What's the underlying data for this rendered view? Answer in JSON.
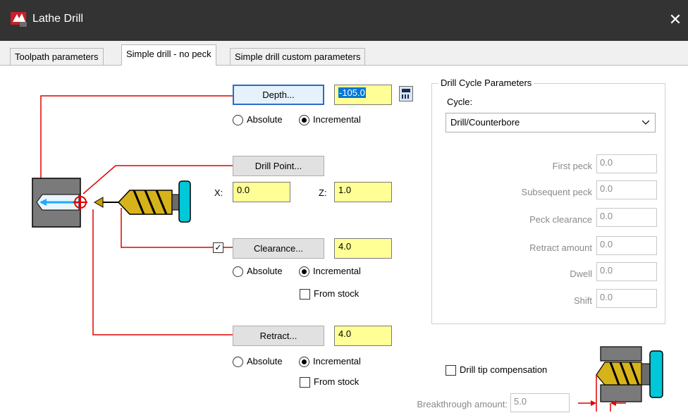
{
  "window": {
    "title": "Lathe Drill",
    "close_glyph": "✕",
    "app_icon": "mastercam-lathe-icon"
  },
  "tabs": [
    {
      "label": "Toolpath parameters"
    },
    {
      "label": "Simple drill - no peck"
    },
    {
      "label": "Simple drill custom parameters"
    }
  ],
  "depth": {
    "button": "Depth...",
    "value": "-105.0",
    "absolute": "Absolute",
    "incremental": "Incremental",
    "mode": "incremental",
    "calc_icon": "calculator-icon"
  },
  "drill_point": {
    "button": "Drill Point...",
    "x_label": "X:",
    "x_value": "0.0",
    "z_label": "Z:",
    "z_value": "1.0"
  },
  "clearance": {
    "enabled": true,
    "check_glyph": "✓",
    "button": "Clearance...",
    "value": "4.0",
    "absolute": "Absolute",
    "incremental": "Incremental",
    "mode": "incremental",
    "from_stock": "From stock",
    "from_stock_checked": false
  },
  "retract": {
    "button": "Retract...",
    "value": "4.0",
    "absolute": "Absolute",
    "incremental": "Incremental",
    "mode": "incremental",
    "from_stock": "From stock",
    "from_stock_checked": false
  },
  "cycle_group": {
    "title": "Drill Cycle Parameters",
    "cycle_label": "Cycle:",
    "cycle_value": "Drill/Counterbore",
    "params": [
      {
        "label": "First peck",
        "value": "0.0"
      },
      {
        "label": "Subsequent peck",
        "value": "0.0"
      },
      {
        "label": "Peck clearance",
        "value": "0.0"
      },
      {
        "label": "Retract amount",
        "value": "0.0"
      },
      {
        "label": "Dwell",
        "value": "0.0"
      },
      {
        "label": "Shift",
        "value": "0.0"
      }
    ]
  },
  "drill_tip": {
    "label": "Drill tip compensation",
    "checked": false
  },
  "breakthrough": {
    "label": "Breakthrough amount:",
    "value": "5.0"
  },
  "colors": {
    "titlebar": "#333333",
    "field_yellow": "#ffff96",
    "leader_red": "#e00000",
    "drill_gold": "#c8a000",
    "holder_cyan": "#00c8d8"
  }
}
